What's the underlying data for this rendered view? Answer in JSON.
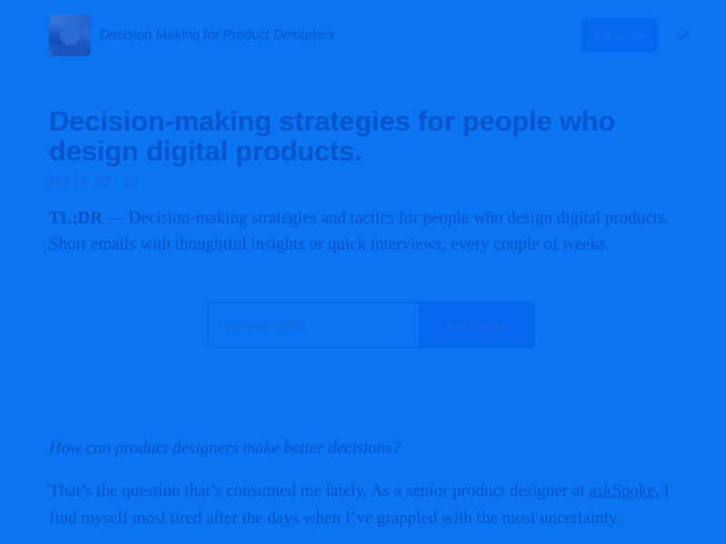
{
  "header": {
    "publication_title": "Decision Making for Product Designers",
    "subscribe_label": "Subscribe",
    "avatar_icon": "author-photo",
    "menu_icon": "chevron-down-icon"
  },
  "post": {
    "title": "Decision-making strategies for people who design digital products.",
    "date": "Mar 19",
    "like_icon": "heart-icon",
    "comment_icon": "comment-icon",
    "tldr_label": "TL;DR",
    "tldr_text": " — Decision-making strategies and tactics for people who design digital products. Short emails with thoughtful insights or quick interviews, every couple of weeks."
  },
  "signup": {
    "email_placeholder": "Type your email...",
    "button_label": "Subscribe"
  },
  "body": {
    "lead_question": "How can product designers make better decisions?",
    "para_start": "That’s the question that’s consumed me lately. As a senior product designer at ",
    "link_text": "askSpoke",
    "para_end": ", I find myself most tired after the days when I’ve grappled with the most uncertainty."
  },
  "colors": {
    "background": "#0a74f2",
    "text": "#0852c4",
    "button": "#0566ee"
  }
}
